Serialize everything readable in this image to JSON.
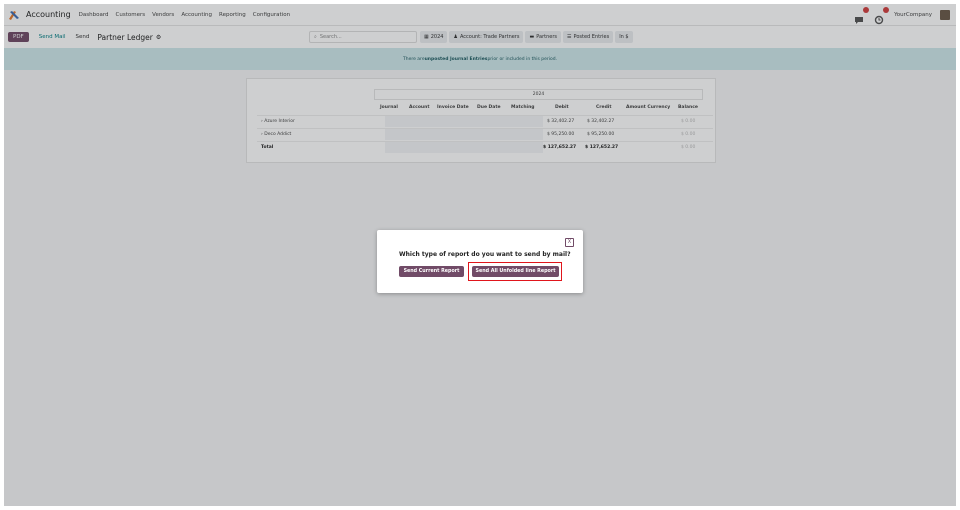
{
  "navbar": {
    "app_name": "Accounting",
    "menu": [
      "Dashboard",
      "Customers",
      "Vendors",
      "Accounting",
      "Reporting",
      "Configuration"
    ],
    "company": "YourCompany",
    "icons": [
      "app-accounting-icon",
      "chat-icon",
      "activity-icon",
      "avatar"
    ]
  },
  "control_panel": {
    "pdf_label": "PDF",
    "send_mail_label": "Send Mail",
    "send_label": "Send",
    "title": "Partner Ledger",
    "search_placeholder": "Search...",
    "filters": [
      "2024",
      "Account: Trade Partners",
      "Partners",
      "Posted Entries",
      "In $"
    ]
  },
  "banner": {
    "prefix": "There are ",
    "bold": "unposted Journal Entries",
    "suffix": " prior or included in this period."
  },
  "report": {
    "period": "2024",
    "columns": [
      "Journal",
      "Account",
      "Invoice Date",
      "Due Date",
      "Matching",
      "Debit",
      "Credit",
      "Amount Currency",
      "Balance"
    ],
    "rows": [
      {
        "label": "Azure Interior",
        "debit": "$ 32,402.27",
        "credit": "$ 32,402.27",
        "balance": "$ 0.00"
      },
      {
        "label": "Deco Addict",
        "debit": "$ 95,250.00",
        "credit": "$ 95,250.00",
        "balance": "$ 0.00"
      },
      {
        "label": "Total",
        "debit": "$ 127,652.27",
        "credit": "$ 127,652.27",
        "balance": "$ 0.00"
      }
    ]
  },
  "modal": {
    "close_label": "X",
    "question": "Which type of report do you want to send by mail?",
    "btn_current": "Send Current Report",
    "btn_all": "Send All Unfolded line Report"
  },
  "colors": {
    "brand": "#714b67",
    "banner_bg": "#cfe8eb",
    "highlight": "#e0151b"
  }
}
